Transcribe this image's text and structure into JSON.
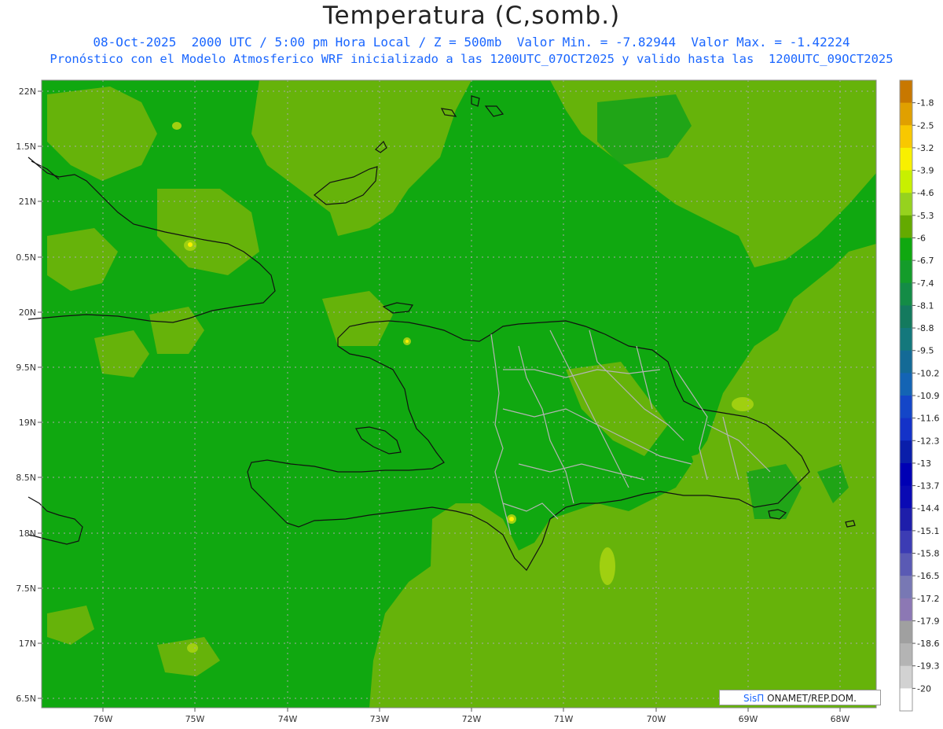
{
  "header": {
    "title": "Temperatura (C,somb.)",
    "line1": "08-Oct-2025  2000 UTC / 5:00 pm Hora Local / Z = 500mb  Valor Min. = -7.82944  Valor Max. = -1.42224",
    "line2": "Pronóstico con el Modelo Atmosferico WRF inicializado a las 1200UTC_07OCT2025 y valido hasta las  1200UTC_09OCT2025"
  },
  "map": {
    "lat_ticks": [
      "22N",
      "1.5N",
      "21N",
      "0.5N",
      "20N",
      "9.5N",
      "19N",
      "8.5N",
      "18N",
      "7.5N",
      "17N",
      "6.5N"
    ],
    "lon_ticks": [
      "76W",
      "75W",
      "74W",
      "73W",
      "72W",
      "71W",
      "70W",
      "69W",
      "68W"
    ],
    "colors": {
      "base_green": "#10a810",
      "light_green": "#66b30a",
      "yellow_green": "#a0d010",
      "coast": "#111111",
      "provinces": "#b4b4b4"
    }
  },
  "colorbar": {
    "labels": [
      "-1.8",
      "-2.5",
      "-3.2",
      "-3.9",
      "-4.6",
      "-5.3",
      "-6",
      "-6.7",
      "-7.4",
      "-8.1",
      "-8.8",
      "-9.5",
      "-10.2",
      "-10.9",
      "-11.6",
      "-12.3",
      "-13",
      "-13.7",
      "-14.4",
      "-15.1",
      "-15.8",
      "-16.5",
      "-17.2",
      "-17.9",
      "-18.6",
      "-19.3",
      "-20"
    ],
    "colors": [
      "#c87800",
      "#e0a000",
      "#f8c800",
      "#f8f000",
      "#c8f000",
      "#96d21e",
      "#64aa00",
      "#10a810",
      "#149c2a",
      "#148c46",
      "#147a5e",
      "#14787c",
      "#146a96",
      "#1464b4",
      "#1446c8",
      "#1432c8",
      "#0a1eaa",
      "#0000b4",
      "#0a0ab4",
      "#1e1eaa",
      "#3c3cb4",
      "#5a5ab4",
      "#7878b4",
      "#8c78b4",
      "#a0a0a0",
      "#b4b4b4",
      "#d2d2d2",
      "#ffffff"
    ]
  },
  "credit": {
    "brand": "SisΠ",
    "text": " ONAMET/REP.DOM."
  }
}
